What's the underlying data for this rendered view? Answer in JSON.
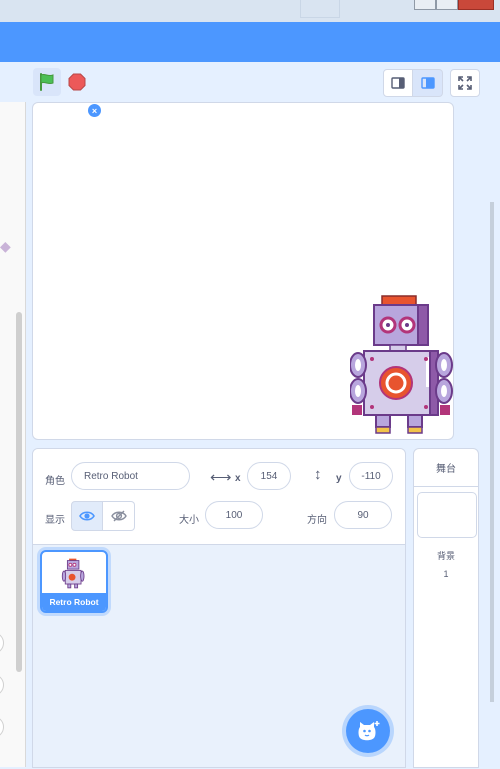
{
  "stage_controls": {
    "green_flag_icon": "green-flag-icon",
    "stop_icon": "stop-icon",
    "accent": "#4c97ff",
    "flag_color": "#4cbf56",
    "stop_color": "#ec5959"
  },
  "sprite_info": {
    "sprite_label": "角色",
    "sprite_name": "Retro Robot",
    "x_label": "x",
    "x_value": "154",
    "y_label": "y",
    "y_value": "-110",
    "show_label": "显示",
    "size_label": "大小",
    "size_value": "100",
    "direction_label": "方向",
    "direction_value": "90"
  },
  "sprites": [
    {
      "name": "Retro Robot",
      "selected": true
    }
  ],
  "stage_pane": {
    "title": "舞台",
    "backdrops_label": "背景",
    "backdrops_count": "1"
  }
}
